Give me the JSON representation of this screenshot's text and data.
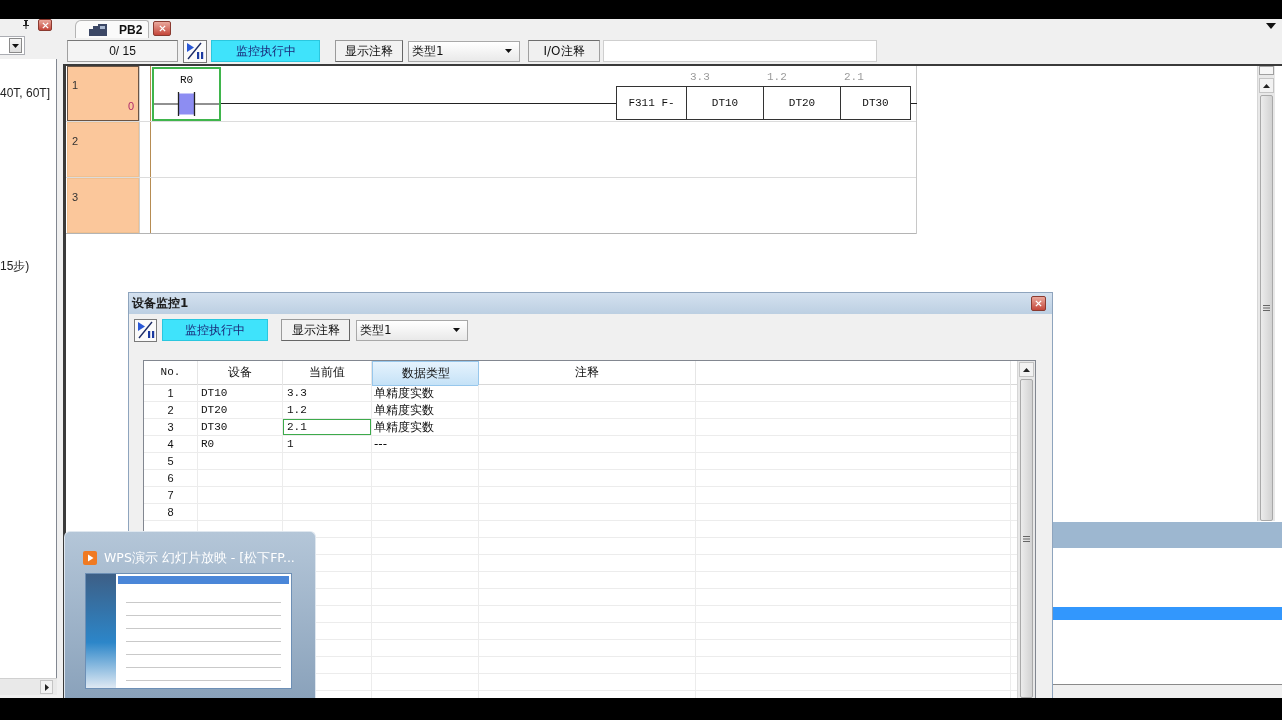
{
  "sidebar": {
    "lines": [
      "40T, 60T]",
      "15步)"
    ]
  },
  "tab_bar": {
    "tabs": [
      {
        "label": "PB2",
        "selected": true
      }
    ]
  },
  "toolbar": {
    "step_counter": "0/ 15",
    "monitoring": true,
    "monitor_status": "监控执行中",
    "comment_button": "显示注释",
    "type_dropdown": "类型1",
    "io_comment_label": "I/O注释"
  },
  "ladder": {
    "rungs": [
      {
        "number": "1",
        "step": "0",
        "selected": true,
        "contact": {
          "device": "R0",
          "on": true,
          "selected": true
        },
        "instruction": [
          {
            "text": "F311 F-"
          },
          {
            "text": "DT10",
            "value": "3.3"
          },
          {
            "text": "DT20",
            "value": "1.2"
          },
          {
            "text": "DT30",
            "value": "2.1"
          }
        ]
      },
      {
        "number": "2",
        "selected": false
      },
      {
        "number": "3",
        "selected": false
      }
    ]
  },
  "device_monitor": {
    "title": "设备监控1",
    "monitoring": true,
    "monitor_status": "监控执行中",
    "comment_button": "显示注释",
    "type_dropdown": "类型1",
    "columns": [
      {
        "label": "No.",
        "selected": false
      },
      {
        "label": "设备",
        "selected": false
      },
      {
        "label": "当前值",
        "selected": false
      },
      {
        "label": "数据类型",
        "selected": true
      },
      {
        "label": "注释",
        "selected": false
      }
    ],
    "rows": [
      {
        "no": "1",
        "device": "DT10",
        "value": "3.3",
        "data_type": "单精度实数",
        "selected": false
      },
      {
        "no": "2",
        "device": "DT20",
        "value": "1.2",
        "data_type": "单精度实数",
        "selected": false
      },
      {
        "no": "3",
        "device": "DT30",
        "value": "2.1",
        "data_type": "单精度实数",
        "selected": true
      },
      {
        "no": "4",
        "device": "R0",
        "value": "1",
        "data_type": "---",
        "selected": false
      },
      {
        "no": "5",
        "selected": false
      },
      {
        "no": "6",
        "selected": false
      },
      {
        "no": "7",
        "selected": false
      },
      {
        "no": "8",
        "selected": false
      }
    ]
  },
  "taskbar_preview": {
    "title": "WPS演示 幻灯片放映 - [松下FP..."
  }
}
